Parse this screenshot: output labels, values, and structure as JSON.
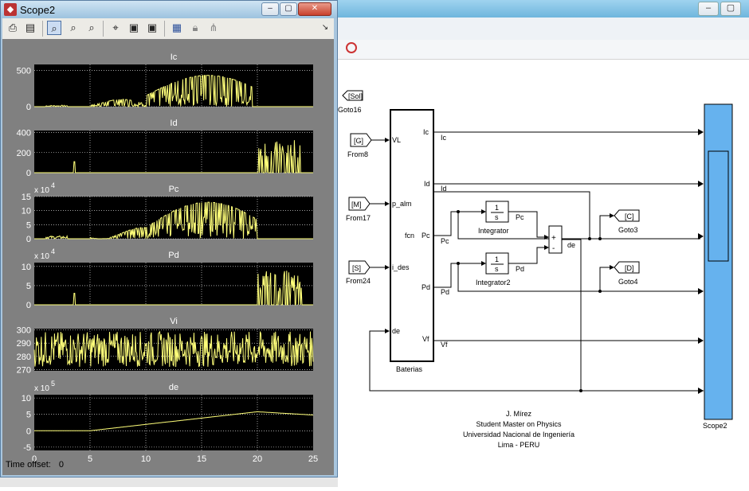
{
  "scope_window": {
    "title": "Scope2",
    "toolbar_icons": [
      "print-icon",
      "parameters-icon",
      "zoom-icon",
      "zoom-x-icon",
      "zoom-y-icon",
      "autoscale-icon",
      "save-axes-icon",
      "restore-axes-icon",
      "floating-scope-icon",
      "lock-axes-icon",
      "signal-selector-icon"
    ],
    "time_offset_label": "Time offset:",
    "time_offset_value": "0",
    "plots": [
      {
        "title": "Ic",
        "yticks": [
          "500",
          "0"
        ],
        "exponent": ""
      },
      {
        "title": "Id",
        "yticks": [
          "400",
          "200",
          "0"
        ],
        "exponent": ""
      },
      {
        "title": "Pc",
        "yticks": [
          "15",
          "10",
          "5",
          "0"
        ],
        "exponent": "x 10",
        "exponent_power": "4"
      },
      {
        "title": "Pd",
        "yticks": [
          "10",
          "5",
          "0"
        ],
        "exponent": "x 10",
        "exponent_power": "4"
      },
      {
        "title": "Vi",
        "yticks": [
          "300",
          "290",
          "280",
          "270"
        ],
        "exponent": ""
      },
      {
        "title": "de",
        "yticks": [
          "10",
          "5",
          "0",
          "-5"
        ],
        "exponent": "x 10",
        "exponent_power": "5"
      }
    ],
    "xticks": [
      "0",
      "5",
      "10",
      "15",
      "20",
      "25"
    ]
  },
  "diagram": {
    "subsystem": {
      "name": "Baterias",
      "inputs": [
        "VL",
        "p_alm",
        "i_des",
        "de"
      ],
      "outputs": [
        "Ic",
        "Id",
        "Pc",
        "Pd",
        "Vf"
      ],
      "side_label": "fcn"
    },
    "from_blocks": [
      {
        "tag": "[G]",
        "name": "From8"
      },
      {
        "tag": "[M]",
        "name": "From17"
      },
      {
        "tag": "[S]",
        "name": "From24"
      }
    ],
    "goto_blocks": [
      {
        "tag": "[Sol]",
        "name": "Goto16"
      },
      {
        "tag": "[C]",
        "name": "Goto3"
      },
      {
        "tag": "[D]",
        "name": "Goto4"
      }
    ],
    "integrators": [
      {
        "name": "Integrator",
        "num": "1",
        "den": "s",
        "out": "Pc",
        "in": "Pc"
      },
      {
        "name": "Integrator2",
        "num": "1",
        "den": "s",
        "out": "Pd",
        "in": "Pd"
      }
    ],
    "sum_block": {
      "signs": [
        "+",
        "-"
      ],
      "out": "de"
    },
    "signal_labels": [
      "Ic",
      "Id",
      "Vf"
    ],
    "scope_name": "Scope2",
    "credits": [
      "J. Mírez",
      "Student Master on Physics",
      "Universidad Nacional de Ingeniería",
      "Lima - PERU"
    ]
  },
  "colors": {
    "trace": "#ffff7a",
    "plot_bg": "#000000",
    "scope_bg": "#808080",
    "simulink_scope": "#66b2ee"
  }
}
